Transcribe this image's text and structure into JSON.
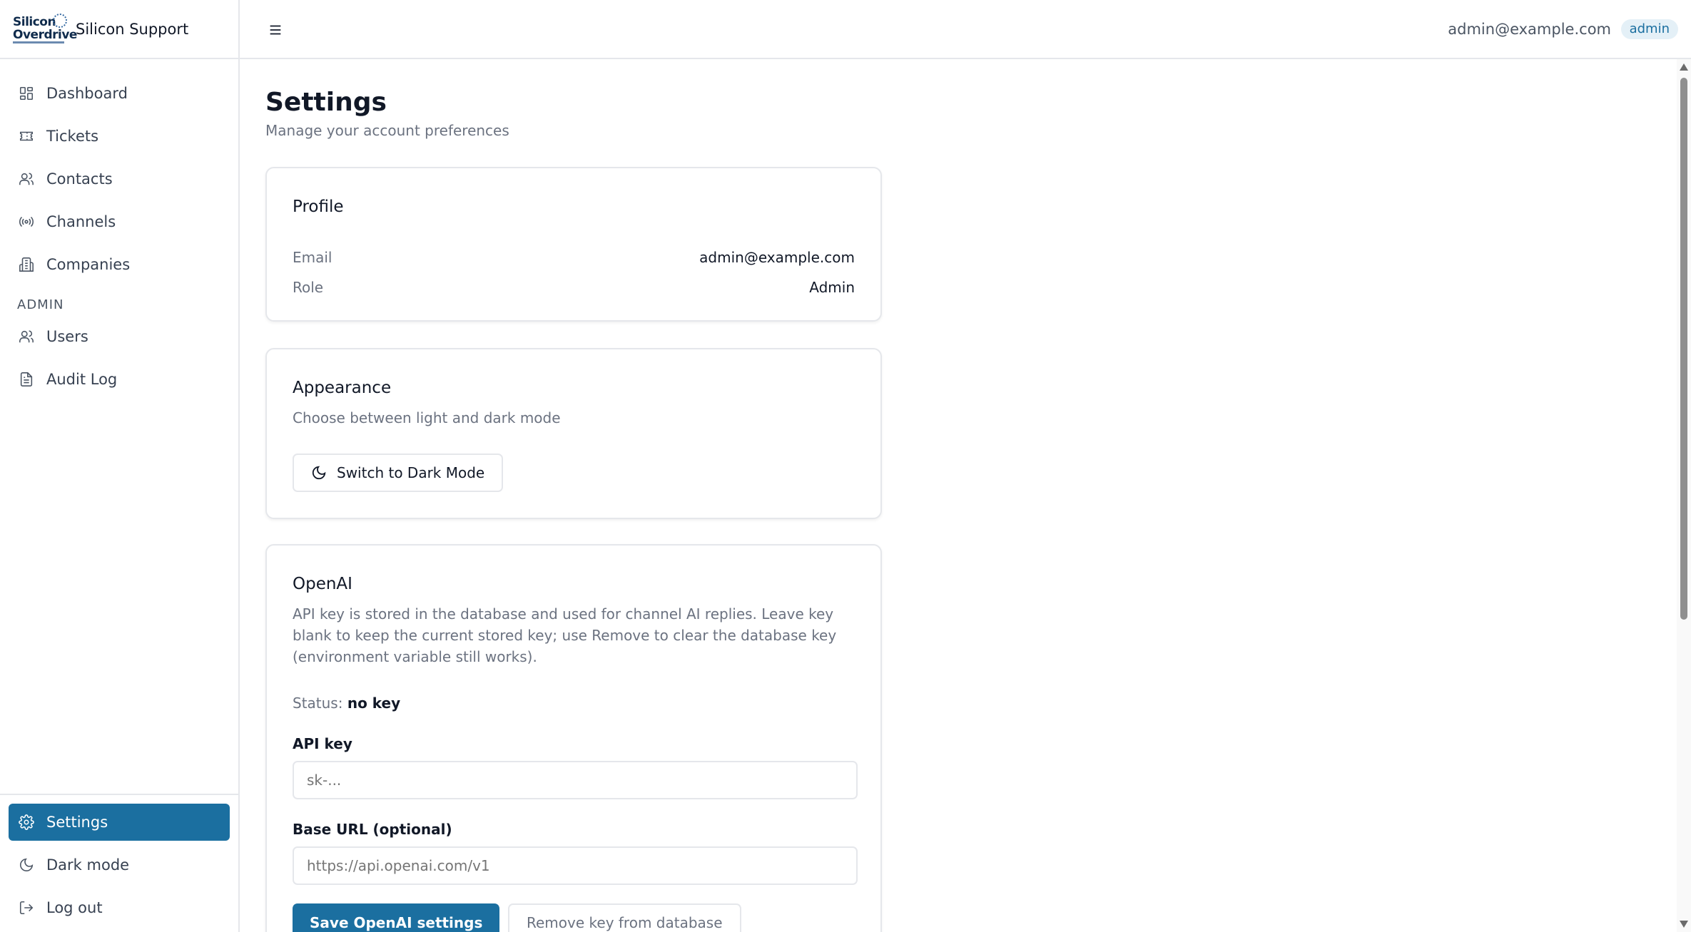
{
  "brand": {
    "logo_line1": "Silicon",
    "logo_line2": "Overdrive",
    "name": "Silicon Support"
  },
  "sidebar": {
    "items": [
      {
        "label": "Dashboard",
        "icon": "dashboard-icon"
      },
      {
        "label": "Tickets",
        "icon": "ticket-icon"
      },
      {
        "label": "Contacts",
        "icon": "users-icon"
      },
      {
        "label": "Channels",
        "icon": "radio-icon"
      },
      {
        "label": "Companies",
        "icon": "building-icon"
      }
    ],
    "admin_section_label": "ADMIN",
    "admin_items": [
      {
        "label": "Users",
        "icon": "users-icon"
      },
      {
        "label": "Audit Log",
        "icon": "file-icon"
      }
    ],
    "bottom_items": [
      {
        "label": "Settings",
        "icon": "gear-icon",
        "active": true
      },
      {
        "label": "Dark mode",
        "icon": "moon-icon"
      },
      {
        "label": "Log out",
        "icon": "logout-icon"
      }
    ]
  },
  "topbar": {
    "user_email": "admin@example.com",
    "role_badge": "admin"
  },
  "page": {
    "title": "Settings",
    "subtitle": "Manage your account preferences"
  },
  "profile": {
    "title": "Profile",
    "email_label": "Email",
    "email_value": "admin@example.com",
    "role_label": "Role",
    "role_value": "Admin"
  },
  "appearance": {
    "title": "Appearance",
    "description": "Choose between light and dark mode",
    "toggle_label": "Switch to Dark Mode"
  },
  "openai": {
    "title": "OpenAI",
    "description": "API key is stored in the database and used for channel AI replies. Leave key blank to keep the current stored key; use Remove to clear the database key (environment variable still works).",
    "status_label": "Status:",
    "status_value": "no key",
    "api_key_label": "API key",
    "api_key_placeholder": "sk-...",
    "api_key_value": "",
    "base_url_label": "Base URL (optional)",
    "base_url_placeholder": "https://api.openai.com/v1",
    "base_url_value": "",
    "save_label": "Save OpenAI settings",
    "remove_label": "Remove key from database"
  },
  "colors": {
    "accent": "#1b6fa0",
    "badge_bg": "#e4f0f7",
    "border": "#e5e7eb",
    "muted_text": "#6b7280"
  }
}
